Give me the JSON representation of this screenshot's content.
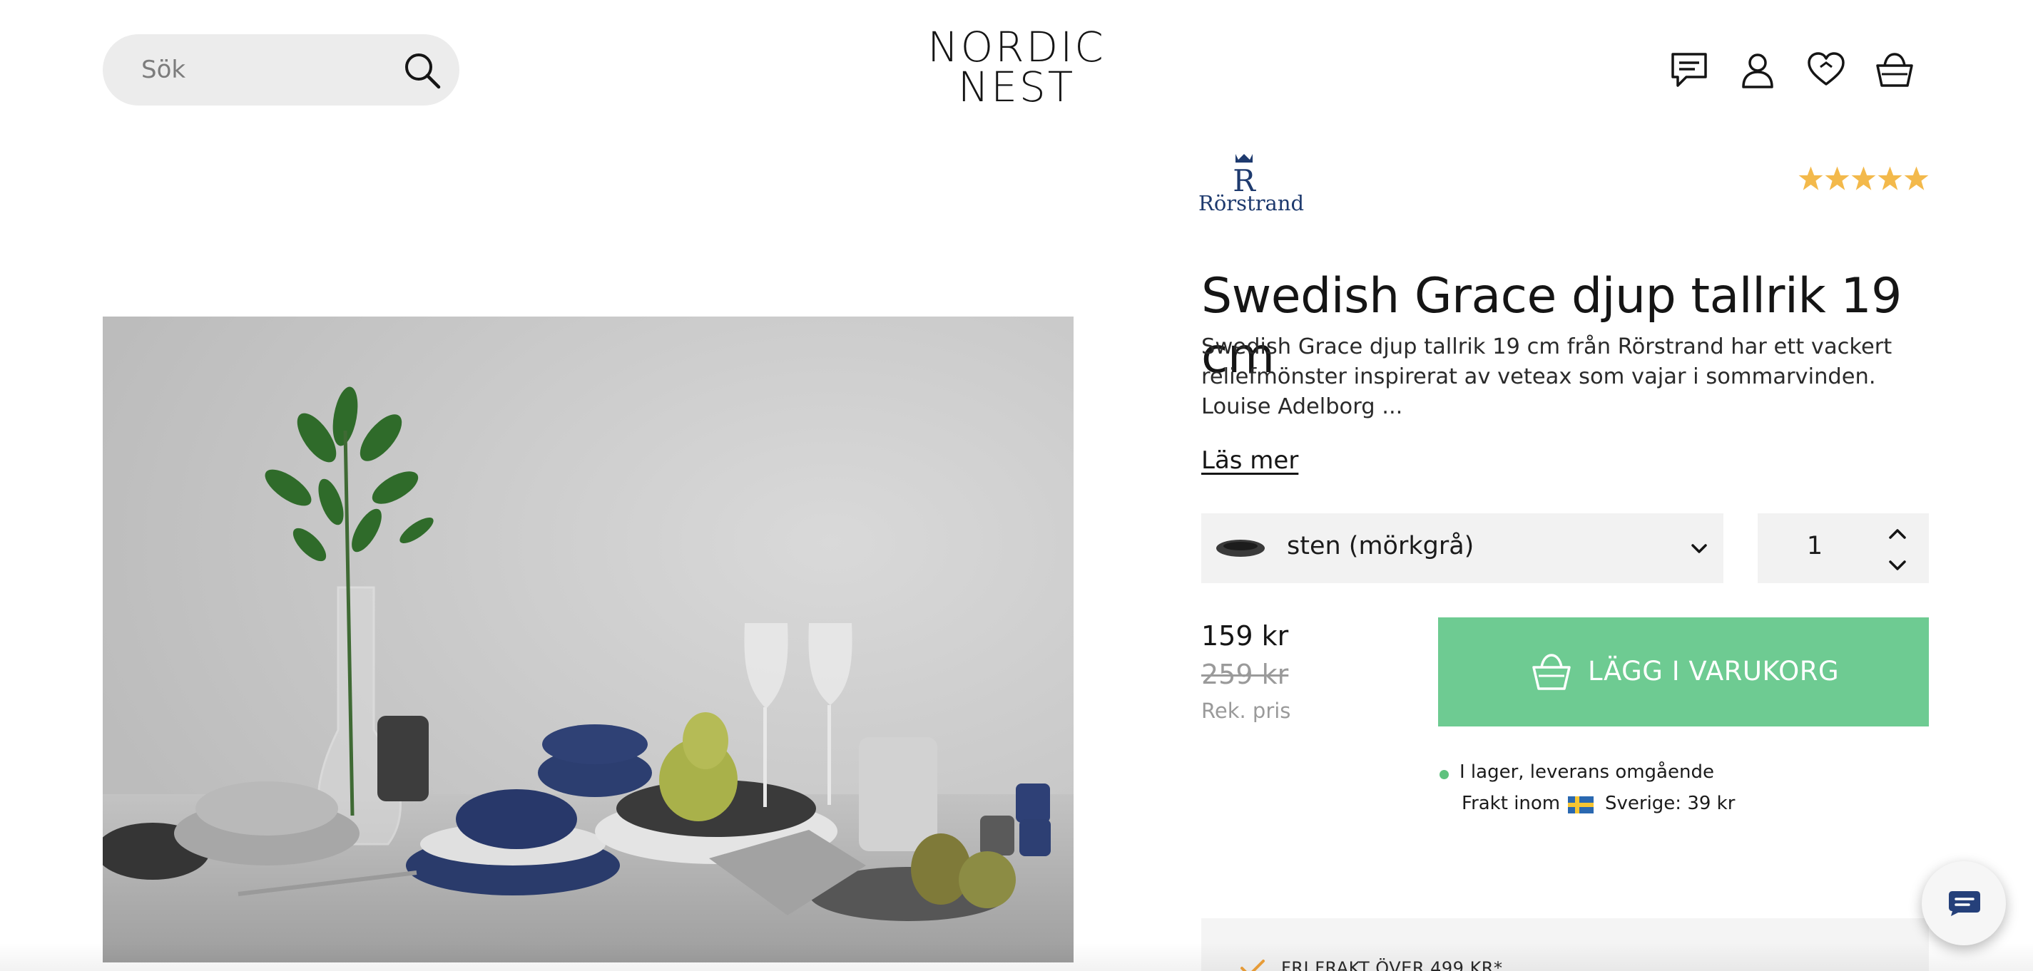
{
  "header": {
    "search_placeholder": "Sök",
    "logo_line1": "NORDIC",
    "logo_line2": "NEST",
    "icons": [
      "chat-icon",
      "account-icon",
      "wishlist-heart-icon",
      "cart-basket-icon"
    ]
  },
  "product": {
    "brand": "Rörstrand",
    "rating_stars": 5,
    "title": "Swedish Grace djup tallrik 19 cm",
    "description": "Swedish Grace djup tallrik 19 cm från Rörstrand har ett vackert reliefmönster inspirerat av veteax som vajar i sommarvinden. Louise Adelborg ...",
    "read_more": "Läs mer",
    "variant": "sten (mörkgrå)",
    "quantity": "1",
    "price": "159 kr",
    "old_price": "259 kr",
    "price_note": "Rek. pris",
    "add_to_cart": "LÄGG I VARUKORG",
    "stock": "I lager, leverans omgående",
    "shipping_label": "Frakt inom",
    "shipping_price": "Sverige: 39 kr",
    "usp": "FRI FRAKT ÖVER 499 KR*"
  },
  "colors": {
    "accent_green": "#6ecb92",
    "star_gold": "#f3b94b",
    "brand_blue": "#1e3a6e",
    "stock_green": "#5fc27e"
  }
}
